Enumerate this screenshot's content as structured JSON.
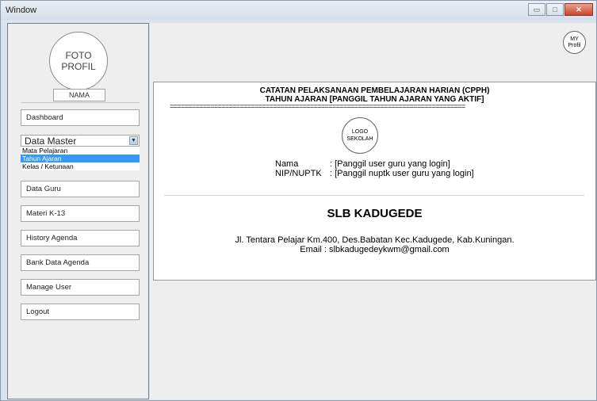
{
  "window": {
    "title": "Window"
  },
  "sidebar": {
    "photo_line1": "FOTO",
    "photo_line2": "PROFIL",
    "name_label": "NAMA",
    "items": [
      {
        "label": "Dashboard"
      },
      {
        "label": "Data Guru"
      },
      {
        "label": "Materi K-13"
      },
      {
        "label": "History Agenda"
      },
      {
        "label": "Bank Data Agenda"
      },
      {
        "label": "Manage User"
      },
      {
        "label": "Logout"
      }
    ],
    "data_master": {
      "selected": "Data Master",
      "options": [
        "Mata Pelajaran",
        "Tahun Ajaran",
        "Kelas / Ketunaan"
      ],
      "highlighted": "Tahun Ajaran"
    }
  },
  "header": {
    "my_profile_line1": "MY",
    "my_profile_line2": "Profil"
  },
  "panel": {
    "title1": "CATATAN PELAKSANAAN PEMBELAJARAN HARIAN (CPPH)",
    "title2": "TAHUN AJARAN [PANGGIL TAHUN AJARAN YANG AKTIF]",
    "rule": "================================================================================",
    "logo_line1": "LOGO",
    "logo_line2": "SEKOLAH",
    "nama_label": "Nama",
    "nama_value": ": [Panggil user guru yang login]",
    "nip_label": "NIP/NUPTK",
    "nip_value": ": [Panggil nuptk user guru yang login]",
    "school_name": "SLB KADUGEDE",
    "address": "Jl. Tentara Pelajar Km.400, Des.Babatan Kec.Kadugede, Kab.Kuningan.",
    "email": "Email : slbkadugedeykwm@gmail.com"
  },
  "colors": {
    "selection": "#3399ff",
    "window_bg": "#dbe4ee",
    "panel_bg": "#eeeeee"
  }
}
